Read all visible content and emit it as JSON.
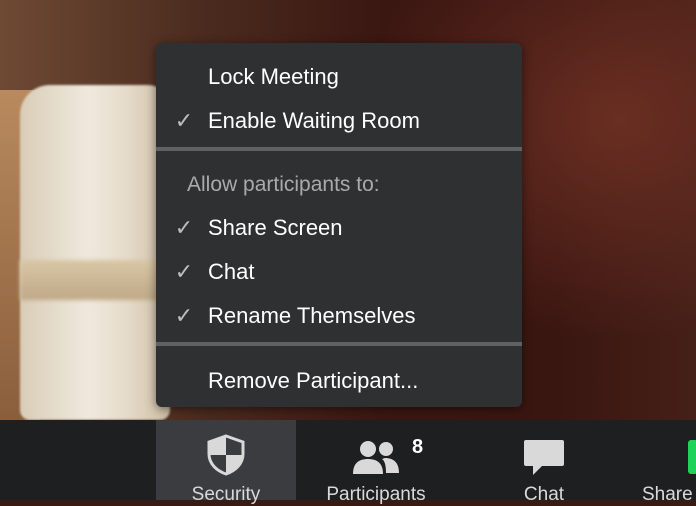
{
  "menu": {
    "items_top": [
      {
        "label": "Lock Meeting",
        "checked": false
      },
      {
        "label": "Enable Waiting Room",
        "checked": true
      }
    ],
    "section_header": "Allow participants to:",
    "items_allow": [
      {
        "label": "Share Screen",
        "checked": true
      },
      {
        "label": "Chat",
        "checked": true
      },
      {
        "label": "Rename Themselves",
        "checked": true
      }
    ],
    "items_bottom": [
      {
        "label": "Remove Participant..."
      }
    ],
    "check_glyph": "✓"
  },
  "toolbar": {
    "security": {
      "label": "Security",
      "icon": "shield-icon"
    },
    "participants": {
      "label": "Participants",
      "icon": "people-icon",
      "count": "8"
    },
    "chat": {
      "label": "Chat",
      "icon": "chat-bubble-icon"
    },
    "share": {
      "label": "Share Screen",
      "icon": "share-screen-icon",
      "accent": "#1fd35a"
    }
  },
  "colors": {
    "menu_bg": "#2f3032",
    "menu_text": "#ffffff",
    "header_text": "#a9aaac",
    "toolbar_bg": "#1e1f21",
    "active_tool_bg": "#3b3c3f"
  }
}
